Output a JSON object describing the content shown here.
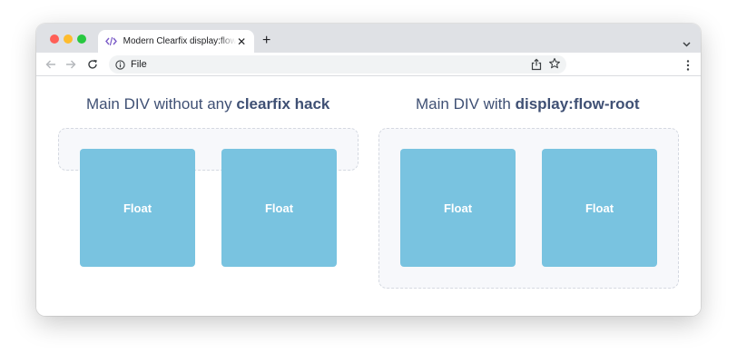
{
  "browser": {
    "tab_title": "Modern Clearfix display:flow-root",
    "tab_icon": "code-icon",
    "address": "File"
  },
  "colors": {
    "float_fill": "#79c3e0",
    "heading_text": "#3f5074",
    "container_fill": "#f7f8fb",
    "container_border": "#d5d9e1"
  },
  "left_demo": {
    "heading_prefix": "Main DIV without any ",
    "heading_bold": "clearfix hack",
    "float_labels": [
      "Float",
      "Float"
    ]
  },
  "right_demo": {
    "heading_prefix": "Main DIV with ",
    "heading_bold": "display:flow-root",
    "float_labels": [
      "Float",
      "Float"
    ]
  }
}
